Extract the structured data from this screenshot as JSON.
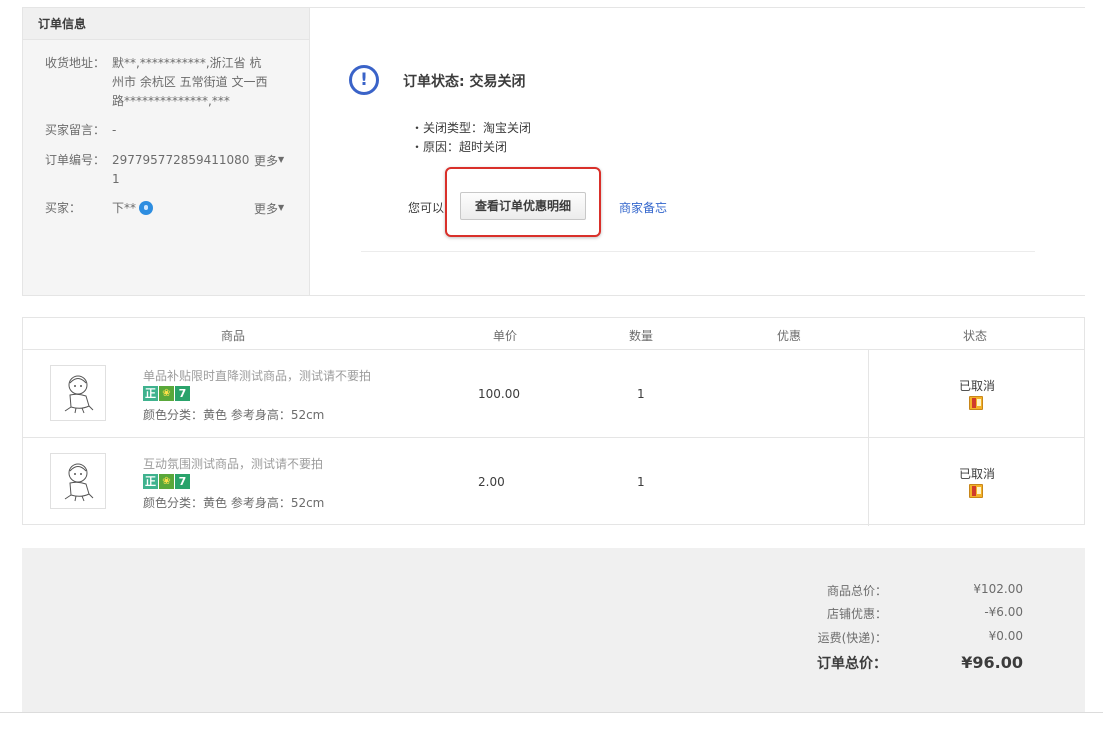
{
  "order_info": {
    "title": "订单信息",
    "address_label": "收货地址：",
    "address_line1": "默**,***********,浙江省 杭",
    "address_line2": "州市 余杭区 五常街道 文一西",
    "address_line3": "路**************,***",
    "message_label": "买家留言：",
    "message_value": "-",
    "order_no_label": "订单编号：",
    "order_no_line1": "297795772859411080",
    "order_no_line2": "1",
    "more_label": "更多",
    "buyer_label": "买家：",
    "buyer_value": "下**"
  },
  "status": {
    "icon": "!",
    "title": "订单状态: 交易关闭",
    "close_type": "・关闭类型：淘宝关闭",
    "reason": "・原因：超时关闭",
    "you_can": "您可以",
    "detail_button": "查看订单优惠明细",
    "memo_link": "商家备忘"
  },
  "table": {
    "headers": [
      "商品",
      "单价",
      "数量",
      "优惠",
      "状态"
    ],
    "items": [
      {
        "title": "单品补贴限时直降测试商品，测试请不要拍",
        "badges": [
          "正",
          "❀",
          "7"
        ],
        "spec": "颜色分类：黄色 参考身高：52cm",
        "price": "100.00",
        "qty": "1",
        "status": "已取消"
      },
      {
        "title": "互动氛围测试商品，测试请不要拍",
        "badges": [
          "正",
          "❀",
          "7"
        ],
        "spec": "颜色分类：黄色 参考身高：52cm",
        "price": "2.00",
        "qty": "1",
        "status": "已取消"
      }
    ]
  },
  "summary": {
    "goods_label": "商品总价：",
    "goods_value": "¥102.00",
    "discount_label": "店铺优惠：",
    "discount_value": "-¥6.00",
    "shipping_label": "运费(快递)：",
    "shipping_value": "¥0.00",
    "total_label": "订单总价：",
    "total_value": "¥96.00"
  },
  "colors": {
    "accent_blue": "#3366cc",
    "status_icon": "#3a63c8",
    "highlight_red": "#d9302a"
  }
}
